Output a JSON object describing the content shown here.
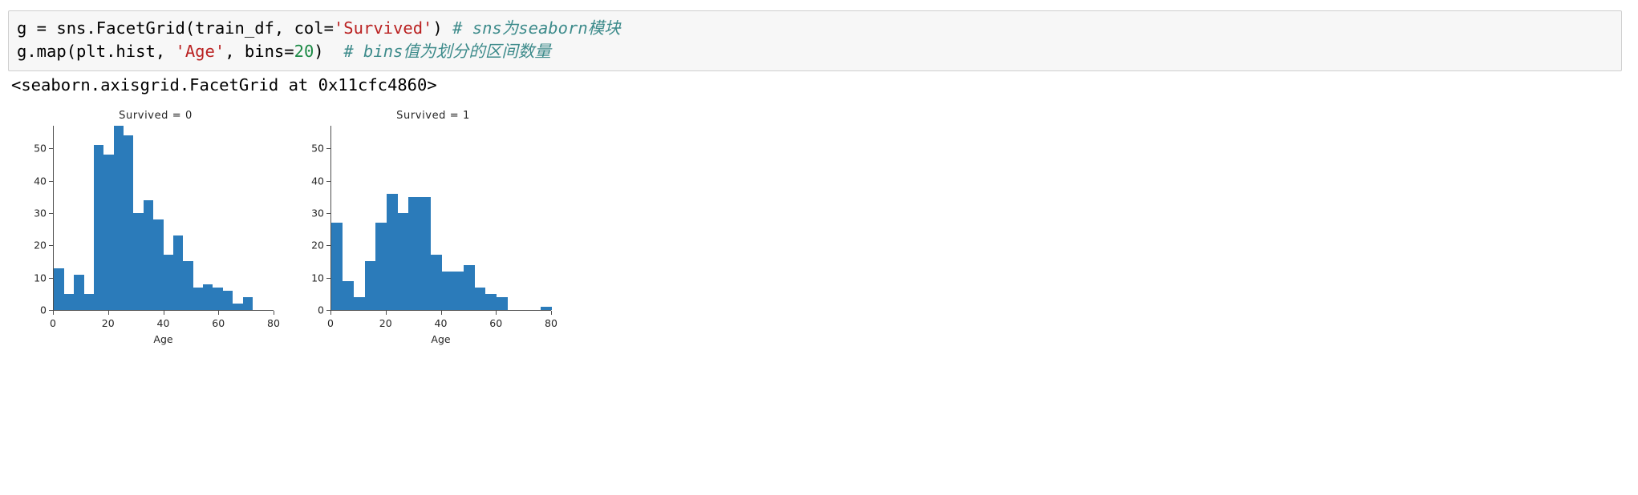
{
  "cell": {
    "code_lines": [
      [
        {
          "t": "plain",
          "s": "g = sns.FacetGrid(train_df, col="
        },
        {
          "t": "str",
          "s": "'Survived'"
        },
        {
          "t": "plain",
          "s": ") "
        },
        {
          "t": "cmt",
          "s": "# sns为seaborn模块"
        }
      ],
      [
        {
          "t": "plain",
          "s": "g.map(plt.hist, "
        },
        {
          "t": "str",
          "s": "'Age'"
        },
        {
          "t": "plain",
          "s": ", bins="
        },
        {
          "t": "num",
          "s": "20"
        },
        {
          "t": "plain",
          "s": ")  "
        },
        {
          "t": "cmt",
          "s": "# bins值为划分的区间数量"
        }
      ]
    ],
    "output_text": "<seaborn.axisgrid.FacetGrid at 0x11cfc4860>"
  },
  "colors": {
    "bar": "#2b7bba",
    "string_token": "#ba2121",
    "number_token": "#1c8a46",
    "comment_token": "#3d8b8b",
    "cell_background": "#f7f7f7",
    "cell_border": "#cfcfcf",
    "axis": "#4d4d4d"
  },
  "chart_data": [
    {
      "type": "bar",
      "title": "Survived = 0",
      "xlabel": "Age",
      "ylabel": "",
      "xlim": [
        0,
        80
      ],
      "ylim": [
        0,
        57
      ],
      "xticks": [
        0,
        20,
        40,
        60,
        80
      ],
      "yticks": [
        0,
        10,
        20,
        30,
        40,
        50
      ],
      "grid": false,
      "legend": "none",
      "bin_edges": [
        0.42,
        4.02,
        7.62,
        11.22,
        14.82,
        18.42,
        22.02,
        25.62,
        29.22,
        32.82,
        36.42,
        40.02,
        43.62,
        47.22,
        50.82,
        54.42,
        58.02,
        61.62,
        65.22,
        68.82,
        72.42
      ],
      "categories": [
        "0.4-4.0",
        "4.0-7.6",
        "7.6-11.2",
        "11.2-14.8",
        "14.8-18.4",
        "18.4-22.0",
        "22.0-25.6",
        "25.6-29.2",
        "29.2-32.8",
        "32.8-36.4",
        "36.4-40.0",
        "40.0-43.6",
        "43.6-47.2",
        "47.2-50.8",
        "50.8-54.4",
        "54.4-58.0",
        "58.0-61.6",
        "61.6-65.2",
        "65.2-68.8",
        "68.8-72.4"
      ],
      "values": [
        13,
        5,
        11,
        5,
        51,
        48,
        57,
        54,
        30,
        34,
        28,
        17,
        23,
        15,
        7,
        8,
        7,
        6,
        2,
        4
      ]
    },
    {
      "type": "bar",
      "title": "Survived = 1",
      "xlabel": "Age",
      "ylabel": "",
      "xlim": [
        0,
        80
      ],
      "ylim": [
        0,
        57
      ],
      "xticks": [
        0,
        20,
        40,
        60,
        80
      ],
      "yticks": [
        0,
        10,
        20,
        30,
        40,
        50
      ],
      "grid": false,
      "legend": "none",
      "bin_edges": [
        0.42,
        4.41,
        8.4,
        12.39,
        16.38,
        20.37,
        24.36,
        28.35,
        32.34,
        36.33,
        40.32,
        44.31,
        48.3,
        52.29,
        56.28,
        60.27,
        64.26,
        68.25,
        72.24,
        76.23,
        80.22
      ],
      "categories": [
        "0.4-4.4",
        "4.4-8.4",
        "8.4-12.4",
        "12.4-16.4",
        "16.4-20.4",
        "20.4-24.4",
        "24.4-28.4",
        "28.4-32.4",
        "32.4-36.3",
        "36.3-40.3",
        "40.3-44.3",
        "44.3-48.3",
        "48.3-52.3",
        "52.3-56.3",
        "56.3-60.3",
        "60.3-64.3",
        "64.3-68.3",
        "68.3-72.2",
        "72.2-76.2",
        "76.2-80.2"
      ],
      "values": [
        27,
        9,
        4,
        15,
        27,
        36,
        30,
        35,
        35,
        17,
        12,
        12,
        14,
        7,
        5,
        4,
        0,
        0,
        0,
        1
      ]
    }
  ]
}
